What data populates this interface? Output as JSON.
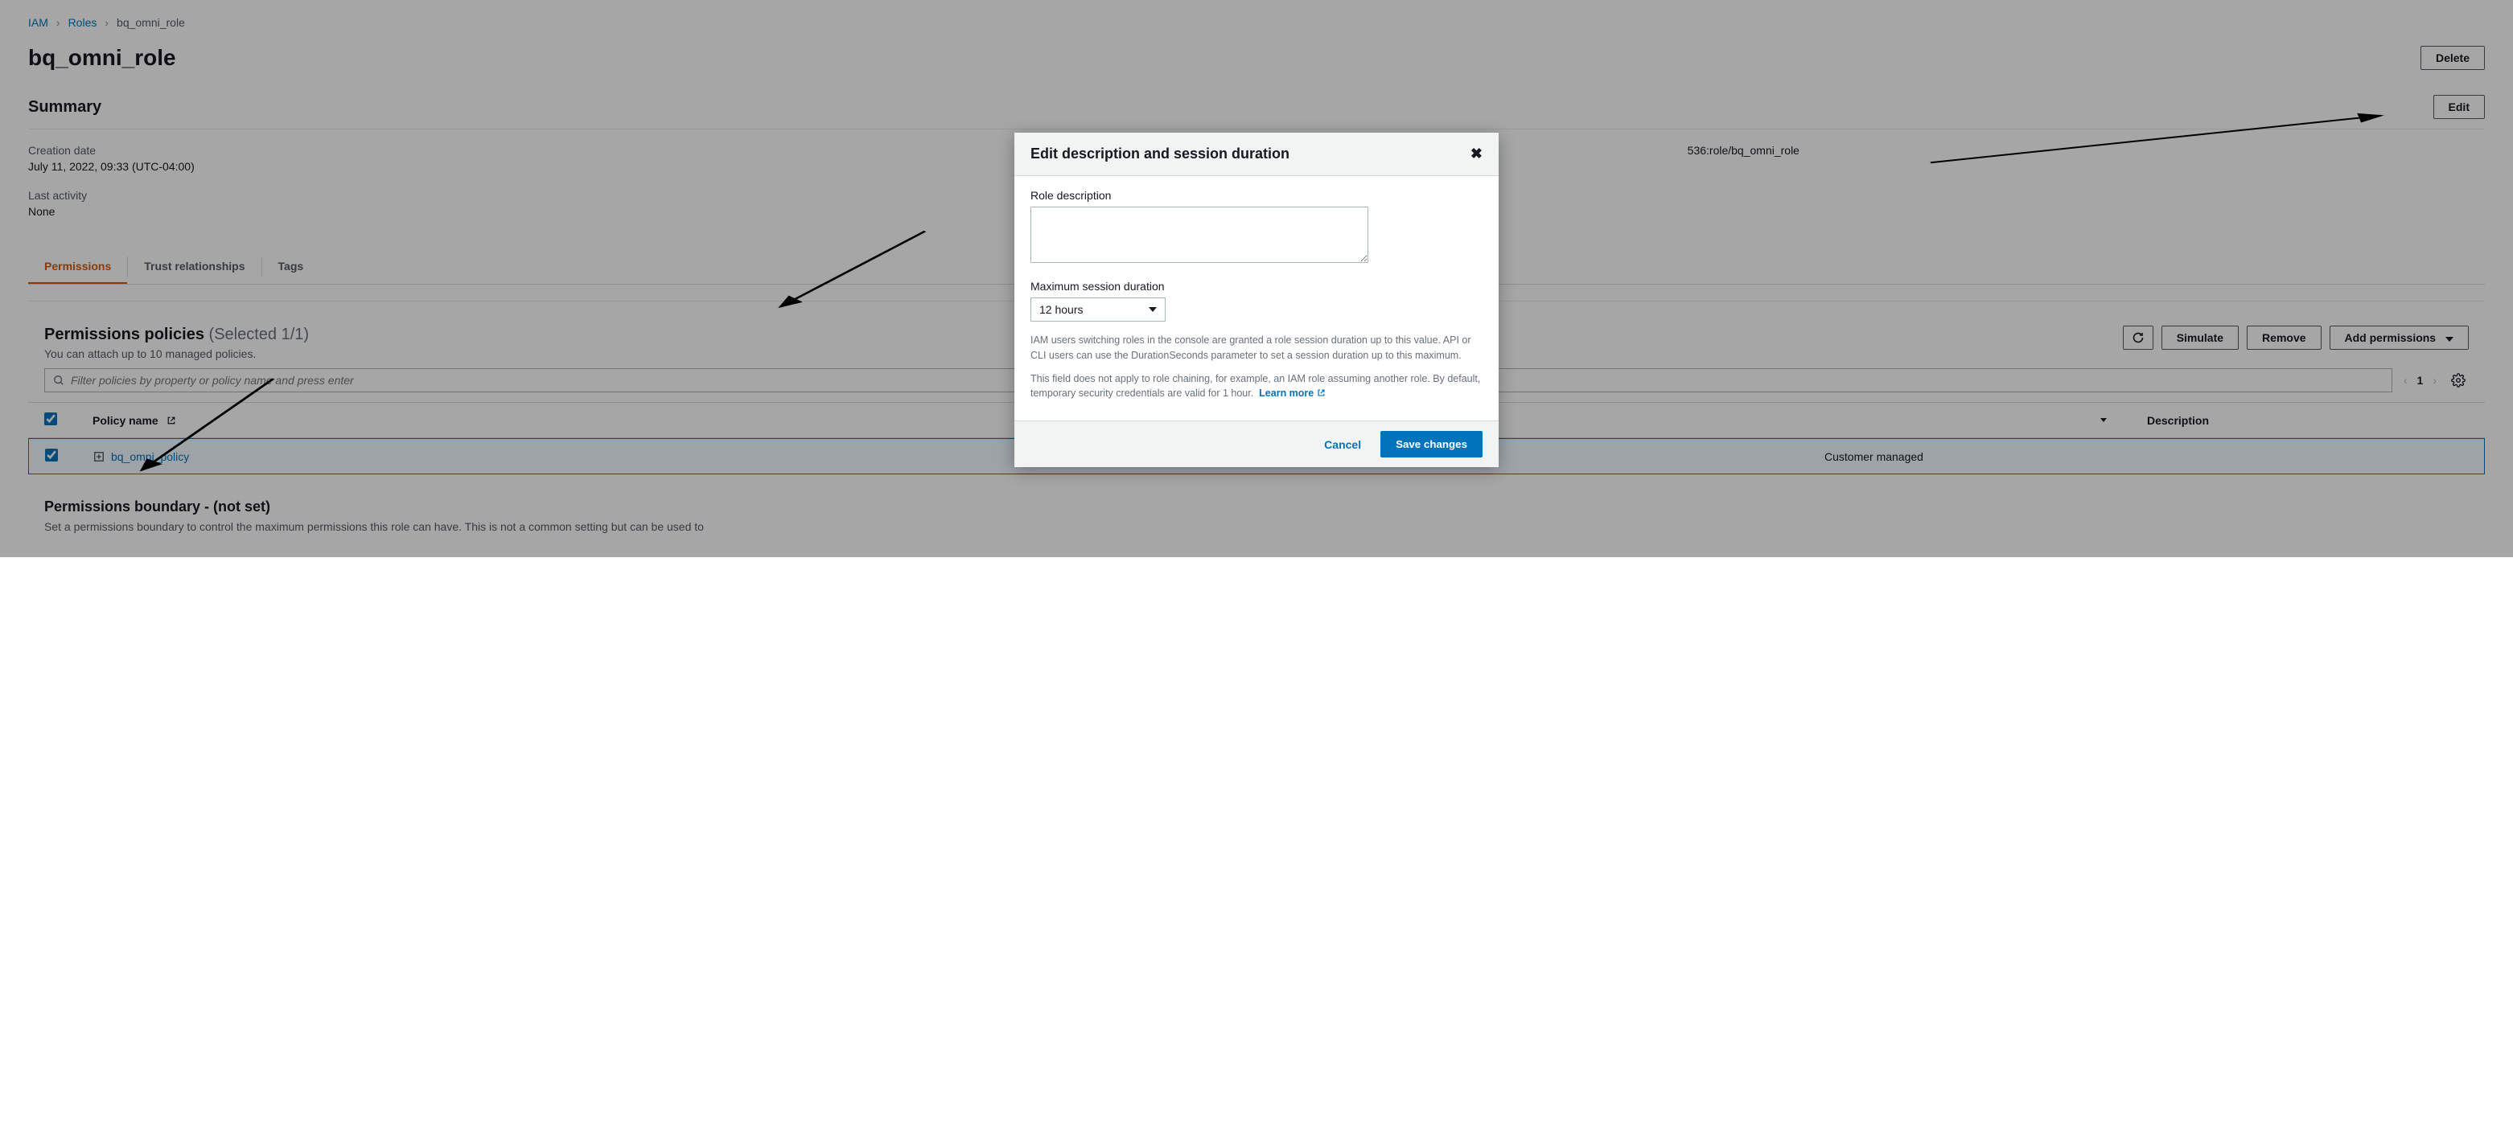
{
  "breadcrumb": {
    "root": "IAM",
    "section": "Roles",
    "current": "bq_omni_role"
  },
  "page": {
    "title": "bq_omni_role",
    "delete_label": "Delete"
  },
  "summary": {
    "heading": "Summary",
    "edit_label": "Edit",
    "creation_date_label": "Creation date",
    "creation_date_value": "July 11, 2022, 09:33 (UTC-04:00)",
    "last_activity_label": "Last activity",
    "last_activity_value": "None",
    "arn_fragment": "536:role/bq_omni_role"
  },
  "tabs": {
    "permissions": "Permissions",
    "trust": "Trust relationships",
    "tags": "Tags"
  },
  "policies": {
    "title": "Permissions policies",
    "count": "(Selected 1/1)",
    "subtitle": "You can attach up to 10 managed policies.",
    "simulate_label": "Simulate",
    "remove_label": "Remove",
    "add_label": "Add permissions",
    "filter_placeholder": "Filter policies by property or policy name and press enter",
    "page_num": "1",
    "th_policy": "Policy name",
    "th_type": "",
    "th_desc": "Description",
    "row": {
      "name": "bq_omni_policy",
      "type": "Customer managed",
      "desc": ""
    }
  },
  "boundary": {
    "title": "Permissions boundary - (not set)",
    "desc": "Set a permissions boundary to control the maximum permissions this role can have. This is not a common setting but can be used to"
  },
  "modal": {
    "title": "Edit description and session duration",
    "desc_label": "Role description",
    "duration_label": "Maximum session duration",
    "duration_value": "12 hours",
    "help1": "IAM users switching roles in the console are granted a role session duration up to this value. API or CLI users can use the DurationSeconds parameter to set a session duration up to this maximum.",
    "help2": "This field does not apply to role chaining, for example, an IAM role assuming another role. By default, temporary security credentials are valid for 1 hour.",
    "learn_more": "Learn more",
    "cancel_label": "Cancel",
    "save_label": "Save changes"
  }
}
